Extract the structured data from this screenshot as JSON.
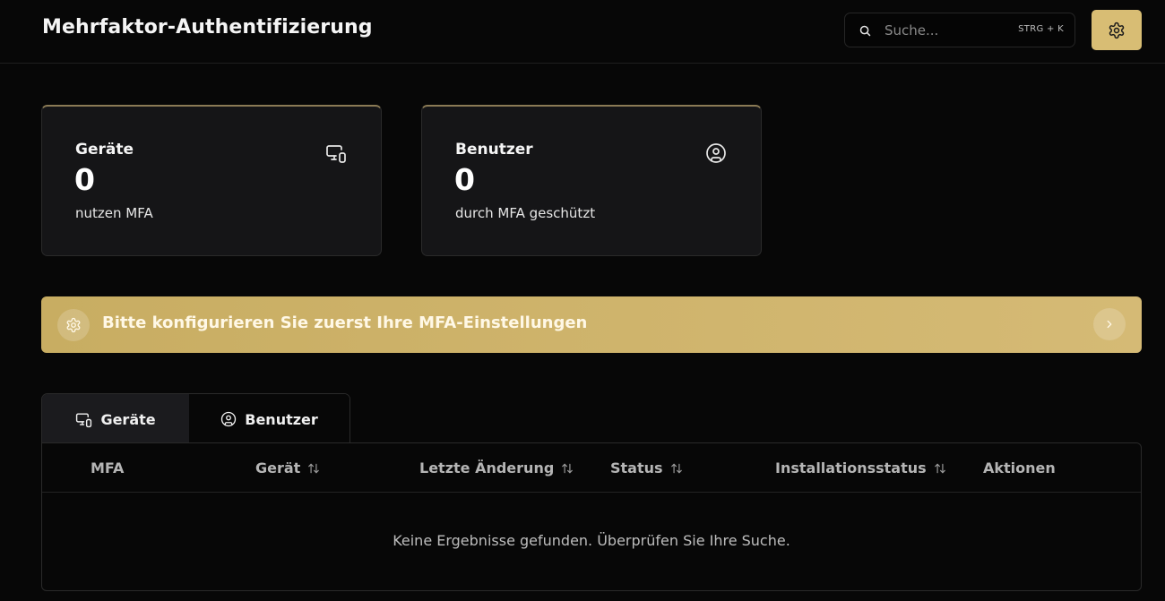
{
  "header": {
    "title": "Mehrfaktor-Authentifizierung",
    "search_placeholder": "Suche...",
    "search_shortcut": "STRG + K"
  },
  "cards": [
    {
      "title": "Geräte",
      "value": "0",
      "subtitle": "nutzen MFA",
      "icon": "devices-icon"
    },
    {
      "title": "Benutzer",
      "value": "0",
      "subtitle": "durch MFA geschützt",
      "icon": "user-circle-icon"
    }
  ],
  "banner": {
    "text": "Bitte konfigurieren Sie zuerst Ihre MFA-Einstellungen",
    "icon": "gear-icon"
  },
  "tabs": [
    {
      "label": "Geräte",
      "icon": "devices-icon",
      "active": true
    },
    {
      "label": "Benutzer",
      "icon": "user-circle-icon",
      "active": false
    }
  ],
  "table": {
    "columns": [
      {
        "label": "MFA",
        "sortable": false
      },
      {
        "label": "Gerät",
        "sortable": true
      },
      {
        "label": "Letzte Änderung",
        "sortable": true
      },
      {
        "label": "Status",
        "sortable": true
      },
      {
        "label": "Installationsstatus",
        "sortable": true
      },
      {
        "label": "Aktionen",
        "sortable": false
      }
    ],
    "empty_message": "Keine Ergebnisse gefunden. Überprüfen Sie Ihre Suche."
  },
  "colors": {
    "accent": "#d8bd74",
    "background": "#070707",
    "card": "#151517"
  }
}
